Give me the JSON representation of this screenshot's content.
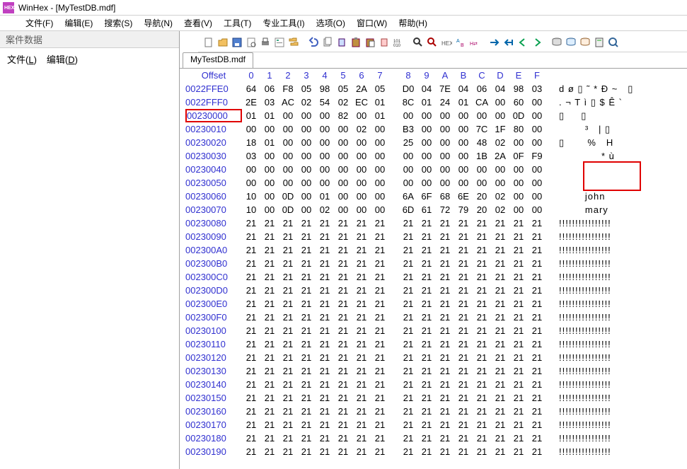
{
  "title": "WinHex - [MyTestDB.mdf]",
  "menu": {
    "file": "文件(F)",
    "edit": "编辑(E)",
    "search": "搜索(S)",
    "nav": "导航(N)",
    "view": "查看(V)",
    "tools": "工具(T)",
    "pro": "专业工具(I)",
    "options": "选项(O)",
    "window": "窗口(W)",
    "help": "帮助(H)"
  },
  "left": {
    "header": "案件数据",
    "file": "文件(L)",
    "edit": "编辑(D)"
  },
  "tab": "MyTestDB.mdf",
  "hex": {
    "offset_label": "Offset",
    "cols": [
      "0",
      "1",
      "2",
      "3",
      "4",
      "5",
      "6",
      "7",
      "8",
      "9",
      "A",
      "B",
      "C",
      "D",
      "E",
      "F"
    ],
    "rows": [
      {
        "off": "0022FFE0",
        "hex": [
          "64",
          "06",
          "F8",
          "05",
          "98",
          "05",
          "2A",
          "05",
          "D0",
          "04",
          "7E",
          "04",
          "06",
          "04",
          "98",
          "03"
        ],
        "asc": "d ø ▯ ˜ * Ð ~   ▯"
      },
      {
        "off": "0022FFF0",
        "hex": [
          "2E",
          "03",
          "AC",
          "02",
          "54",
          "02",
          "EC",
          "01",
          "8C",
          "01",
          "24",
          "01",
          "CA",
          "00",
          "60",
          "00"
        ],
        "asc": ". ¬ T ì ▯ $ Ê `"
      },
      {
        "off": "00230000",
        "hex": [
          "01",
          "01",
          "00",
          "00",
          "00",
          "82",
          "00",
          "01",
          "00",
          "00",
          "00",
          "00",
          "00",
          "00",
          "0D",
          "00"
        ],
        "asc": "▯     ▯            ",
        "sel": true
      },
      {
        "off": "00230010",
        "hex": [
          "00",
          "00",
          "00",
          "00",
          "00",
          "00",
          "02",
          "00",
          "B3",
          "00",
          "00",
          "00",
          "7C",
          "1F",
          "80",
          "00"
        ],
        "asc": "        ³   | ▯"
      },
      {
        "off": "00230020",
        "hex": [
          "18",
          "01",
          "00",
          "00",
          "00",
          "00",
          "00",
          "00",
          "25",
          "00",
          "00",
          "00",
          "48",
          "02",
          "00",
          "00"
        ],
        "asc": "▯       %   H   "
      },
      {
        "off": "00230030",
        "hex": [
          "03",
          "00",
          "00",
          "00",
          "00",
          "00",
          "00",
          "00",
          "00",
          "00",
          "00",
          "00",
          "1B",
          "2A",
          "0F",
          "F9"
        ],
        "asc": "             * ù"
      },
      {
        "off": "00230040",
        "hex": [
          "00",
          "00",
          "00",
          "00",
          "00",
          "00",
          "00",
          "00",
          "00",
          "00",
          "00",
          "00",
          "00",
          "00",
          "00",
          "00"
        ],
        "asc": "                "
      },
      {
        "off": "00230050",
        "hex": [
          "00",
          "00",
          "00",
          "00",
          "00",
          "00",
          "00",
          "00",
          "00",
          "00",
          "00",
          "00",
          "00",
          "00",
          "00",
          "00"
        ],
        "asc": "                "
      },
      {
        "off": "00230060",
        "hex": [
          "10",
          "00",
          "0D",
          "00",
          "01",
          "00",
          "00",
          "00",
          "6A",
          "6F",
          "68",
          "6E",
          "20",
          "02",
          "00",
          "00"
        ],
        "asc": "        john    "
      },
      {
        "off": "00230070",
        "hex": [
          "10",
          "00",
          "0D",
          "00",
          "02",
          "00",
          "00",
          "00",
          "6D",
          "61",
          "72",
          "79",
          "20",
          "02",
          "00",
          "00"
        ],
        "asc": "        mary    "
      },
      {
        "off": "00230080",
        "hex": [
          "21",
          "21",
          "21",
          "21",
          "21",
          "21",
          "21",
          "21",
          "21",
          "21",
          "21",
          "21",
          "21",
          "21",
          "21",
          "21"
        ],
        "asc": "!!!!!!!!!!!!!!!!"
      },
      {
        "off": "00230090",
        "hex": [
          "21",
          "21",
          "21",
          "21",
          "21",
          "21",
          "21",
          "21",
          "21",
          "21",
          "21",
          "21",
          "21",
          "21",
          "21",
          "21"
        ],
        "asc": "!!!!!!!!!!!!!!!!"
      },
      {
        "off": "002300A0",
        "hex": [
          "21",
          "21",
          "21",
          "21",
          "21",
          "21",
          "21",
          "21",
          "21",
          "21",
          "21",
          "21",
          "21",
          "21",
          "21",
          "21"
        ],
        "asc": "!!!!!!!!!!!!!!!!"
      },
      {
        "off": "002300B0",
        "hex": [
          "21",
          "21",
          "21",
          "21",
          "21",
          "21",
          "21",
          "21",
          "21",
          "21",
          "21",
          "21",
          "21",
          "21",
          "21",
          "21"
        ],
        "asc": "!!!!!!!!!!!!!!!!"
      },
      {
        "off": "002300C0",
        "hex": [
          "21",
          "21",
          "21",
          "21",
          "21",
          "21",
          "21",
          "21",
          "21",
          "21",
          "21",
          "21",
          "21",
          "21",
          "21",
          "21"
        ],
        "asc": "!!!!!!!!!!!!!!!!"
      },
      {
        "off": "002300D0",
        "hex": [
          "21",
          "21",
          "21",
          "21",
          "21",
          "21",
          "21",
          "21",
          "21",
          "21",
          "21",
          "21",
          "21",
          "21",
          "21",
          "21"
        ],
        "asc": "!!!!!!!!!!!!!!!!"
      },
      {
        "off": "002300E0",
        "hex": [
          "21",
          "21",
          "21",
          "21",
          "21",
          "21",
          "21",
          "21",
          "21",
          "21",
          "21",
          "21",
          "21",
          "21",
          "21",
          "21"
        ],
        "asc": "!!!!!!!!!!!!!!!!"
      },
      {
        "off": "002300F0",
        "hex": [
          "21",
          "21",
          "21",
          "21",
          "21",
          "21",
          "21",
          "21",
          "21",
          "21",
          "21",
          "21",
          "21",
          "21",
          "21",
          "21"
        ],
        "asc": "!!!!!!!!!!!!!!!!"
      },
      {
        "off": "00230100",
        "hex": [
          "21",
          "21",
          "21",
          "21",
          "21",
          "21",
          "21",
          "21",
          "21",
          "21",
          "21",
          "21",
          "21",
          "21",
          "21",
          "21"
        ],
        "asc": "!!!!!!!!!!!!!!!!"
      },
      {
        "off": "00230110",
        "hex": [
          "21",
          "21",
          "21",
          "21",
          "21",
          "21",
          "21",
          "21",
          "21",
          "21",
          "21",
          "21",
          "21",
          "21",
          "21",
          "21"
        ],
        "asc": "!!!!!!!!!!!!!!!!"
      },
      {
        "off": "00230120",
        "hex": [
          "21",
          "21",
          "21",
          "21",
          "21",
          "21",
          "21",
          "21",
          "21",
          "21",
          "21",
          "21",
          "21",
          "21",
          "21",
          "21"
        ],
        "asc": "!!!!!!!!!!!!!!!!"
      },
      {
        "off": "00230130",
        "hex": [
          "21",
          "21",
          "21",
          "21",
          "21",
          "21",
          "21",
          "21",
          "21",
          "21",
          "21",
          "21",
          "21",
          "21",
          "21",
          "21"
        ],
        "asc": "!!!!!!!!!!!!!!!!"
      },
      {
        "off": "00230140",
        "hex": [
          "21",
          "21",
          "21",
          "21",
          "21",
          "21",
          "21",
          "21",
          "21",
          "21",
          "21",
          "21",
          "21",
          "21",
          "21",
          "21"
        ],
        "asc": "!!!!!!!!!!!!!!!!"
      },
      {
        "off": "00230150",
        "hex": [
          "21",
          "21",
          "21",
          "21",
          "21",
          "21",
          "21",
          "21",
          "21",
          "21",
          "21",
          "21",
          "21",
          "21",
          "21",
          "21"
        ],
        "asc": "!!!!!!!!!!!!!!!!"
      },
      {
        "off": "00230160",
        "hex": [
          "21",
          "21",
          "21",
          "21",
          "21",
          "21",
          "21",
          "21",
          "21",
          "21",
          "21",
          "21",
          "21",
          "21",
          "21",
          "21"
        ],
        "asc": "!!!!!!!!!!!!!!!!"
      },
      {
        "off": "00230170",
        "hex": [
          "21",
          "21",
          "21",
          "21",
          "21",
          "21",
          "21",
          "21",
          "21",
          "21",
          "21",
          "21",
          "21",
          "21",
          "21",
          "21"
        ],
        "asc": "!!!!!!!!!!!!!!!!"
      },
      {
        "off": "00230180",
        "hex": [
          "21",
          "21",
          "21",
          "21",
          "21",
          "21",
          "21",
          "21",
          "21",
          "21",
          "21",
          "21",
          "21",
          "21",
          "21",
          "21"
        ],
        "asc": "!!!!!!!!!!!!!!!!"
      },
      {
        "off": "00230190",
        "hex": [
          "21",
          "21",
          "21",
          "21",
          "21",
          "21",
          "21",
          "21",
          "21",
          "21",
          "21",
          "21",
          "21",
          "21",
          "21",
          "21"
        ],
        "asc": "!!!!!!!!!!!!!!!!"
      }
    ]
  }
}
